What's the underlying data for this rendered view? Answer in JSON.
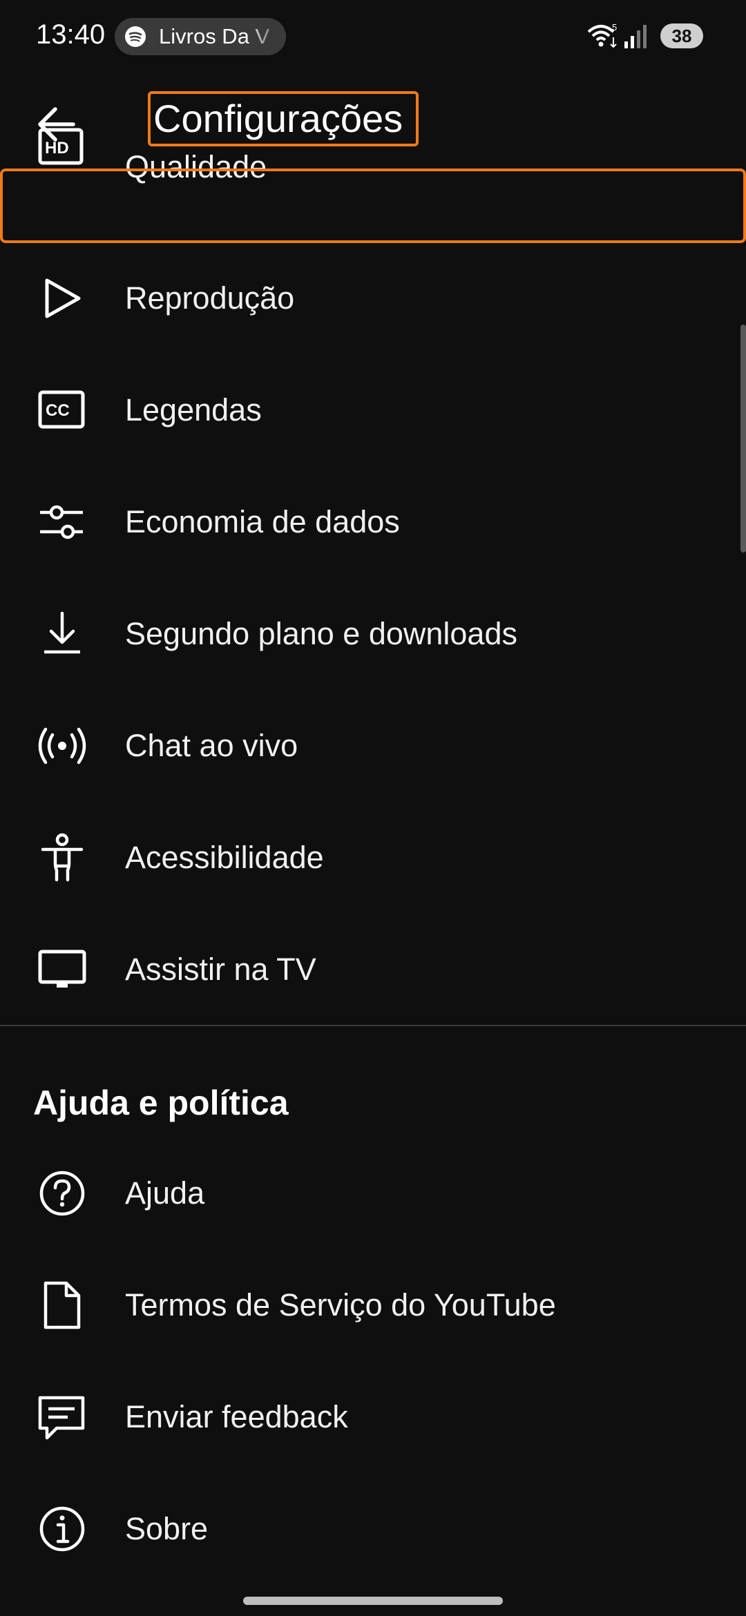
{
  "status_bar": {
    "time": "13:40",
    "media_text": "Livros Da V",
    "wifi_badge": "5",
    "battery": "38"
  },
  "app_bar": {
    "title": "Configurações",
    "back_icon": "arrow-left-icon"
  },
  "settings": [
    {
      "label": "Qualidade",
      "icon": "hd-icon"
    },
    {
      "label": "Reprodução",
      "icon": "play-icon"
    },
    {
      "label": "Legendas",
      "icon": "closed-captions-icon"
    },
    {
      "label": "Economia de dados",
      "icon": "sliders-icon"
    },
    {
      "label": "Segundo plano e downloads",
      "icon": "download-icon"
    },
    {
      "label": "Chat ao vivo",
      "icon": "live-broadcast-icon"
    },
    {
      "label": "Acessibilidade",
      "icon": "accessibility-icon"
    },
    {
      "label": "Assistir na TV",
      "icon": "tv-icon"
    }
  ],
  "help_section": {
    "heading": "Ajuda e política",
    "items": [
      {
        "label": "Ajuda",
        "icon": "help-circle-icon"
      },
      {
        "label": "Termos de Serviço do YouTube",
        "icon": "document-icon"
      },
      {
        "label": "Enviar feedback",
        "icon": "feedback-icon"
      },
      {
        "label": "Sobre",
        "icon": "info-icon"
      }
    ]
  },
  "colors": {
    "background": "#0f0f0f",
    "text": "#f1f1f1",
    "highlight": "#f07a1a"
  }
}
